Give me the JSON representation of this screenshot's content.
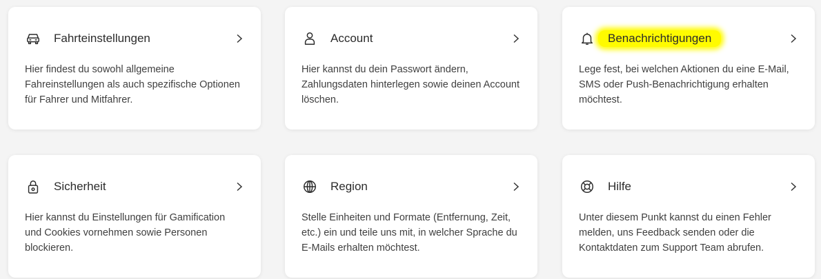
{
  "cards": [
    {
      "icon": "car-icon",
      "title": "Fahrteinstellungen",
      "description": "Hier findest du sowohl allgemeine Fahreinstellungen als auch spezifische Optionen für Fahrer und Mitfahrer."
    },
    {
      "icon": "user-icon",
      "title": "Account",
      "description": "Hier kannst du dein Passwort ändern, Zahlungsdaten hinterlegen sowie deinen Account löschen."
    },
    {
      "icon": "bell-icon",
      "title": "Benachrichtigungen",
      "description": "Lege fest, bei welchen Aktionen du eine E-Mail, SMS oder Push-Benachrichtigung erhalten möchtest."
    },
    {
      "icon": "lock-icon",
      "title": "Sicherheit",
      "description": "Hier kannst du Einstellungen für Gamification und Cookies vornehmen sowie Personen blockieren."
    },
    {
      "icon": "globe-icon",
      "title": "Region",
      "description": "Stelle Einheiten und Formate (Entfernung, Zeit, etc.) ein und teile uns mit, in welcher Sprache du E-Mails erhalten möchtest."
    },
    {
      "icon": "lifebuoy-icon",
      "title": "Hilfe",
      "description": "Unter diesem Punkt kannst du einen Fehler melden, uns Feedback senden oder die Kontaktdaten zum Support Team abrufen."
    }
  ],
  "highlight_color": "#fffb00"
}
